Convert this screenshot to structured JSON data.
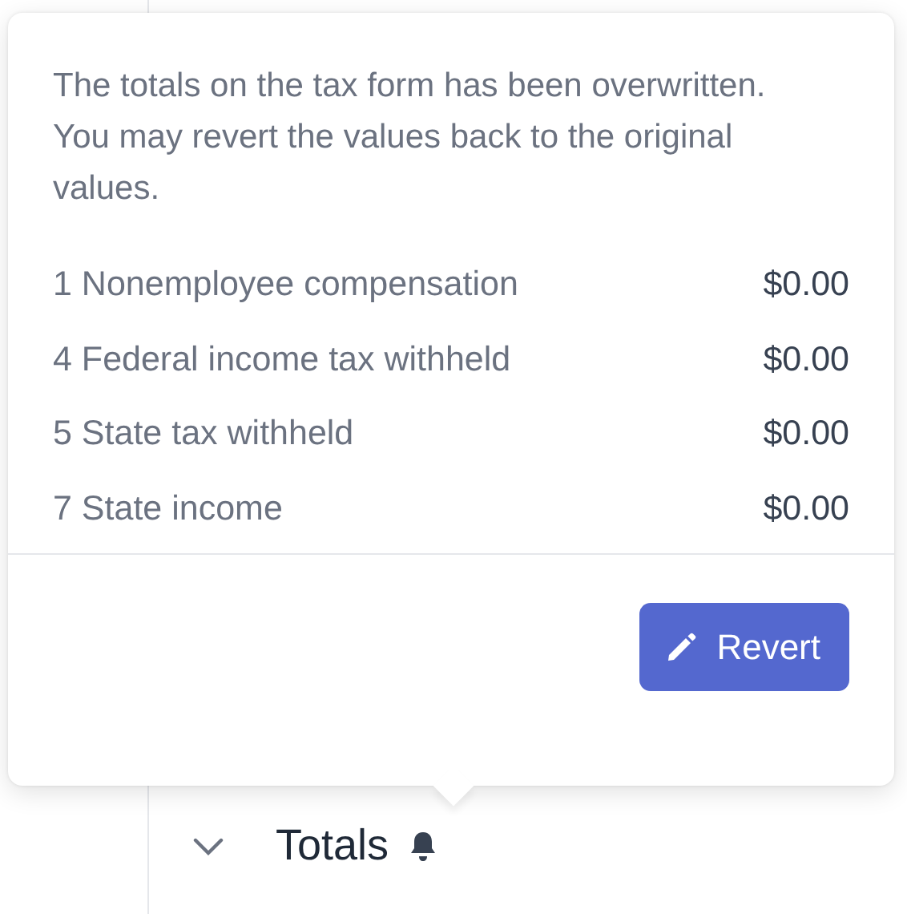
{
  "popover": {
    "message": "The totals on the tax form has been overwritten. You may revert the values back to the original values.",
    "rows": [
      {
        "label": "1 Nonemployee compensation",
        "value": "$0.00"
      },
      {
        "label": "4 Federal income tax withheld",
        "value": "$0.00"
      },
      {
        "label": "5 State tax withheld",
        "value": "$0.00"
      },
      {
        "label": "7 State income",
        "value": "$0.00"
      }
    ],
    "button": "Revert"
  },
  "section": {
    "title": "Totals",
    "expanded": false,
    "alert": true
  }
}
